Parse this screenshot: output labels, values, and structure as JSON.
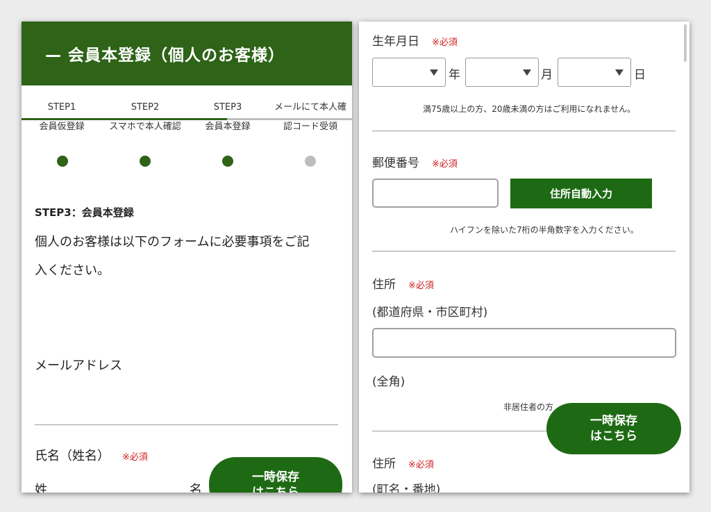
{
  "left": {
    "header_title": "— 会員本登録（個人のお客様）",
    "steps": [
      {
        "line1": "STEP1",
        "line2": "会員仮登録",
        "state": "done"
      },
      {
        "line1": "STEP2",
        "line2": "スマホで本人確認",
        "state": "done"
      },
      {
        "line1": "STEP3",
        "line2": "会員本登録",
        "state": "current"
      },
      {
        "line1": "メールにて本人確",
        "line2": "認コード受領",
        "state": "pending"
      }
    ],
    "section_heading": "STEP3：会員本登録",
    "intro_line1": "個人のお客様は以下のフォームに必要事項をご記",
    "intro_line2": "入ください。",
    "email_label": "メールアドレス",
    "name_label": "氏名（姓名）",
    "required_mark": "※必須",
    "surname_label": "姓",
    "given_label": "名",
    "save_button_line1": "一時保存",
    "save_button_line2": "はこちら"
  },
  "right": {
    "dob_label": "生年月日",
    "required_mark": "※必須",
    "year_unit": "年",
    "month_unit": "月",
    "day_unit": "日",
    "dob_note": "満75歳以上の方、20歳未満の方はご利用になれません。",
    "postal_label": "郵便番号",
    "postal_button": "住所自動入力",
    "postal_note": "ハイフンを除いた7桁の半角数字を入力ください。",
    "address_label": "住所",
    "address_sub": "(都道府県・市区町村)",
    "fullwidth_note": "(全角)",
    "nonresident_note": "非居住者の方",
    "address2_label": "住所",
    "address2_sub": "(町名・番地)",
    "save_button_line1": "一時保存",
    "save_button_line2": "はこちら"
  },
  "colors": {
    "brand_green": "#2e6318",
    "button_green": "#1e6a14",
    "required_red": "#d21e1e",
    "pending_gray": "#bdbdbd"
  }
}
